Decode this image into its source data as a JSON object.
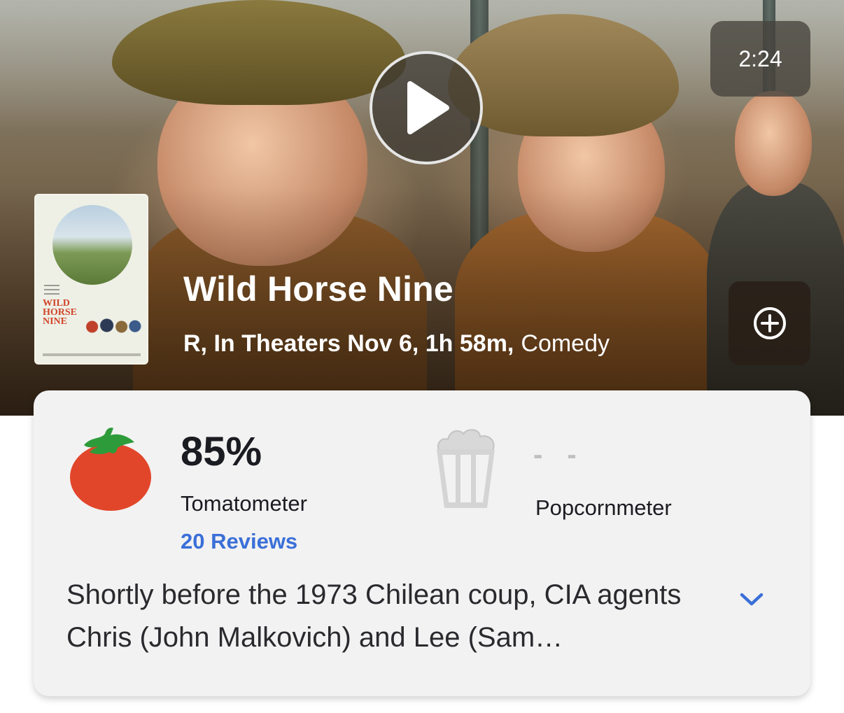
{
  "trailer": {
    "duration": "2:24",
    "play_icon": "play-icon"
  },
  "movie": {
    "title": "Wild Horse Nine",
    "rating_release_runtime": "R, In Theaters Nov 6, 1h 58m,",
    "genre": "Comedy",
    "add_icon": "plus-circle-icon"
  },
  "poster": {
    "title_text": "WILD HORSE NINE"
  },
  "scores": {
    "tomatometer": {
      "value": "85%",
      "label": "Tomatometer",
      "reviews": "20 Reviews",
      "icon": "tomato-icon",
      "color": "#e2462a"
    },
    "popcornmeter": {
      "value": "- -",
      "label": "Popcornmeter",
      "icon": "popcorn-icon"
    }
  },
  "synopsis": {
    "text": "Shortly before the 1973 Chilean coup, CIA agents Chris (John Malkovich) and Lee (Sam…",
    "expand_icon": "chevron-down-icon"
  },
  "colors": {
    "link": "#3a6fd8",
    "card_bg": "#f2f2f2"
  }
}
